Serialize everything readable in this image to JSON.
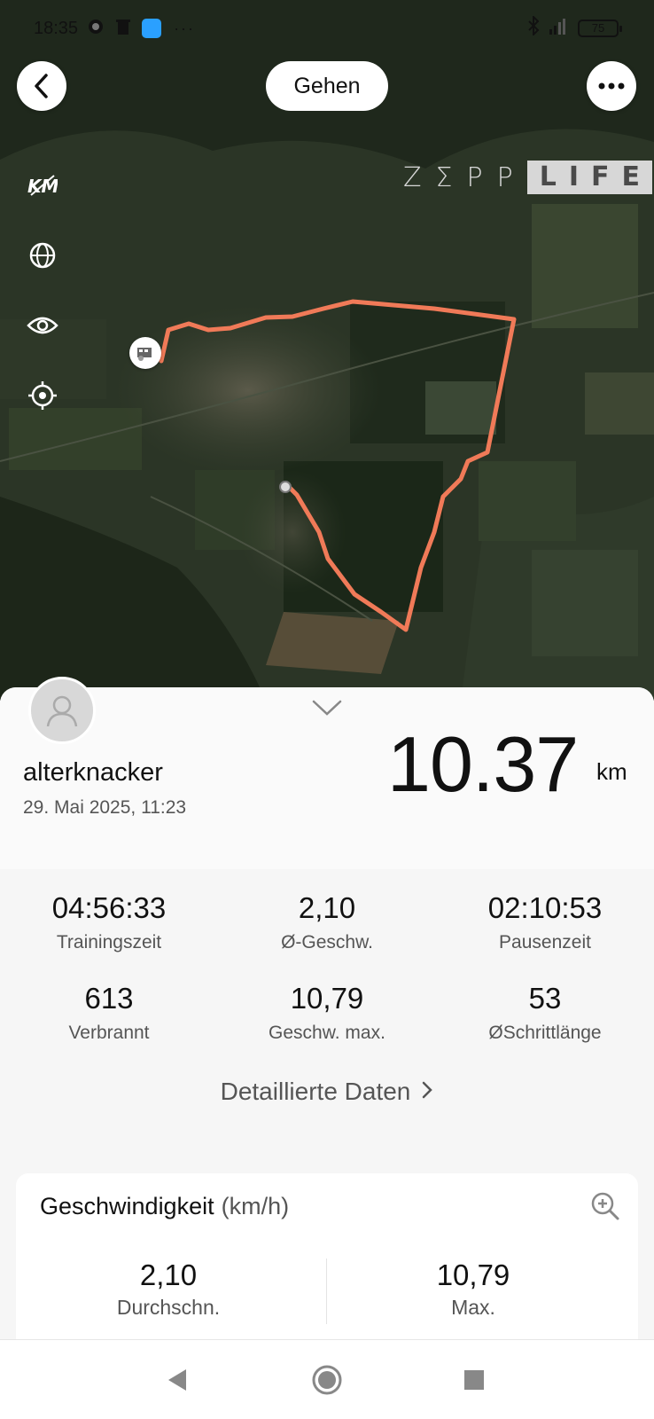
{
  "status_bar": {
    "time": "18:35",
    "battery": "75",
    "dots": "···"
  },
  "header": {
    "activity": "Gehen"
  },
  "map": {
    "logo_part1": "ZΣPP",
    "logo_part2": "LIFE",
    "controls": [
      "km-icon",
      "globe-icon",
      "eye-icon",
      "locate-icon"
    ],
    "route_color": "#f07a58"
  },
  "summary": {
    "username": "alterknacker",
    "datetime": "29. Mai 2025, 11:23",
    "distance": "10.37",
    "distance_unit": "km"
  },
  "stats": [
    {
      "value": "04:56:33",
      "label": "Trainingszeit"
    },
    {
      "value": "2,10",
      "label": "Ø-Geschw."
    },
    {
      "value": "02:10:53",
      "label": "Pausenzeit"
    },
    {
      "value": "613",
      "label": "Verbrannt"
    },
    {
      "value": "10,79",
      "label": "Geschw. max."
    },
    {
      "value": "53",
      "label": "ØSchrittlänge"
    }
  ],
  "detail_link": "Detaillierte Daten",
  "speed_card": {
    "title": "Geschwindigkeit",
    "unit": "(km/h)",
    "avg_value": "2,10",
    "avg_label": "Durchschn.",
    "max_value": "10,79",
    "max_label": "Max."
  }
}
